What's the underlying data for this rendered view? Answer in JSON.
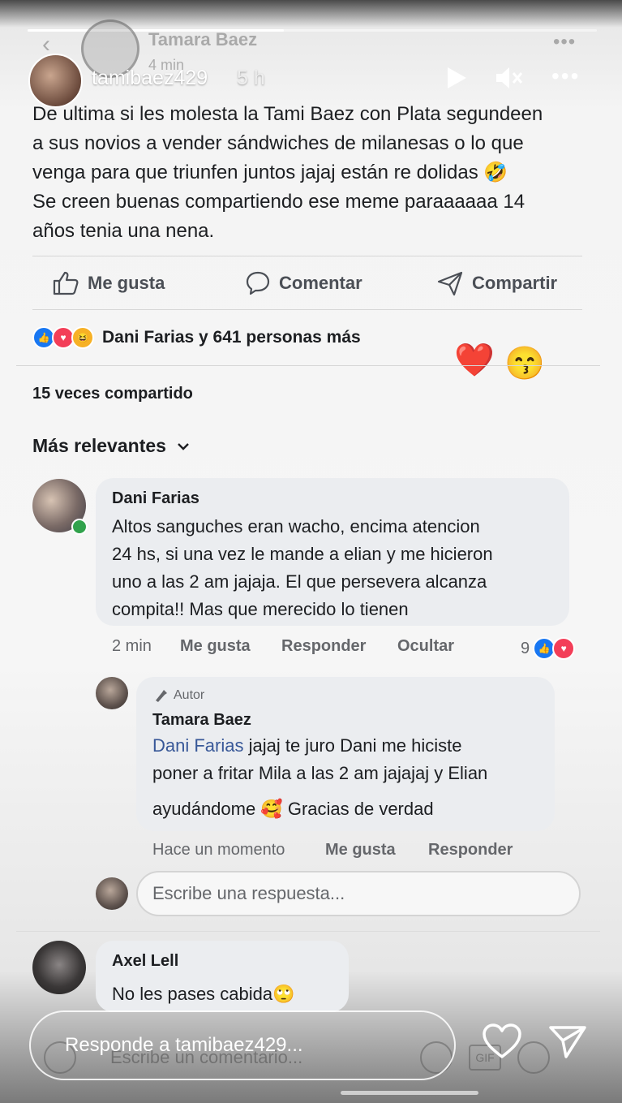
{
  "story": {
    "username": "tamibaez429",
    "time": "5 h",
    "reply_placeholder": "Responde a tamibaez429...",
    "progress": 0.45
  },
  "post": {
    "author": "Tamara Baez",
    "time": "4 min",
    "text_lines": [
      "De ultima si les molesta la Tami Baez con Plata segundeen",
      "a sus novios a vender sándwiches de milanesas o lo que",
      "venga para que triunfen juntos jajaj están re dolidas 🤣",
      "Se creen buenas compartiendo ese meme paraaaaaa 14",
      "años tenia una nena."
    ],
    "actions": {
      "like": "Me gusta",
      "comment": "Comentar",
      "share": "Compartir"
    },
    "reactions_summary": "Dani Farias y 641 personas más",
    "shares": "15 veces compartido",
    "sort_label": "Más relevantes"
  },
  "stickers": {
    "heart": "❤️",
    "kiss": "😙"
  },
  "comments": [
    {
      "name": "Dani Farias",
      "lines": [
        "Altos sanguches eran wacho, encima atencion",
        "24 hs, si una vez le mande a elian y me hicieron",
        "uno a las 2 am jajaja. El que persevera alcanza",
        "compita!! Mas que merecido lo tienen"
      ],
      "time": "2 min",
      "like": "Me gusta",
      "reply": "Responder",
      "hide": "Ocultar",
      "reaction_count": "9"
    }
  ],
  "reply": {
    "badge": "Autor",
    "name": "Tamara Baez",
    "mention": "Dani Farias",
    "line1_rest": " jajaj te juro Dani me hiciste",
    "line2": "poner a fritar Mila a las 2 am jajajaj y Elian",
    "line3": "ayudándome 🥰 Gracias de verdad",
    "time": "Hace un momento",
    "like": "Me gusta",
    "reply": "Responder"
  },
  "reply_input_placeholder": "Escribe una respuesta...",
  "comment2": {
    "name": "Axel Lell",
    "text": "No les  pases cabida🙄"
  },
  "comment_input_placeholder": "Escribe un comentario..."
}
